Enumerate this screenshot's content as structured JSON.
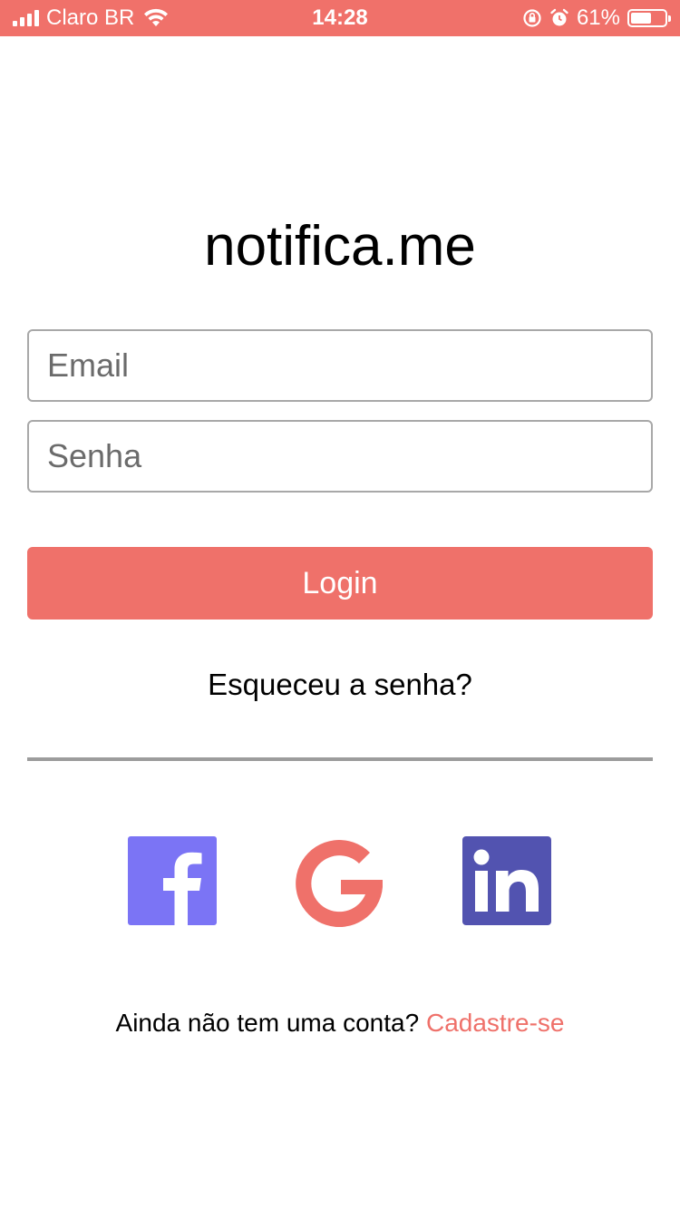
{
  "status_bar": {
    "carrier": "Claro BR",
    "time": "14:28",
    "battery_percent": "61%",
    "battery_level": 0.61,
    "icons": [
      "signal-icon",
      "wifi-icon",
      "orientation-lock-icon",
      "alarm-icon",
      "battery-icon"
    ]
  },
  "app": {
    "title": "notifica.me"
  },
  "form": {
    "email_placeholder": "Email",
    "password_placeholder": "Senha",
    "login_label": "Login",
    "forgot_password": "Esqueceu a senha?"
  },
  "social": {
    "facebook_icon": "facebook-icon",
    "google_icon": "google-icon",
    "linkedin_icon": "linkedin-icon",
    "colors": {
      "facebook": "#7b74f5",
      "google": "#ef716a",
      "linkedin": "#5253b0"
    }
  },
  "signup": {
    "question": "Ainda não tem uma conta?",
    "link": "Cadastre-se"
  },
  "colors": {
    "accent": "#ef716a",
    "text": "#000000",
    "border": "#a8a8a8"
  }
}
